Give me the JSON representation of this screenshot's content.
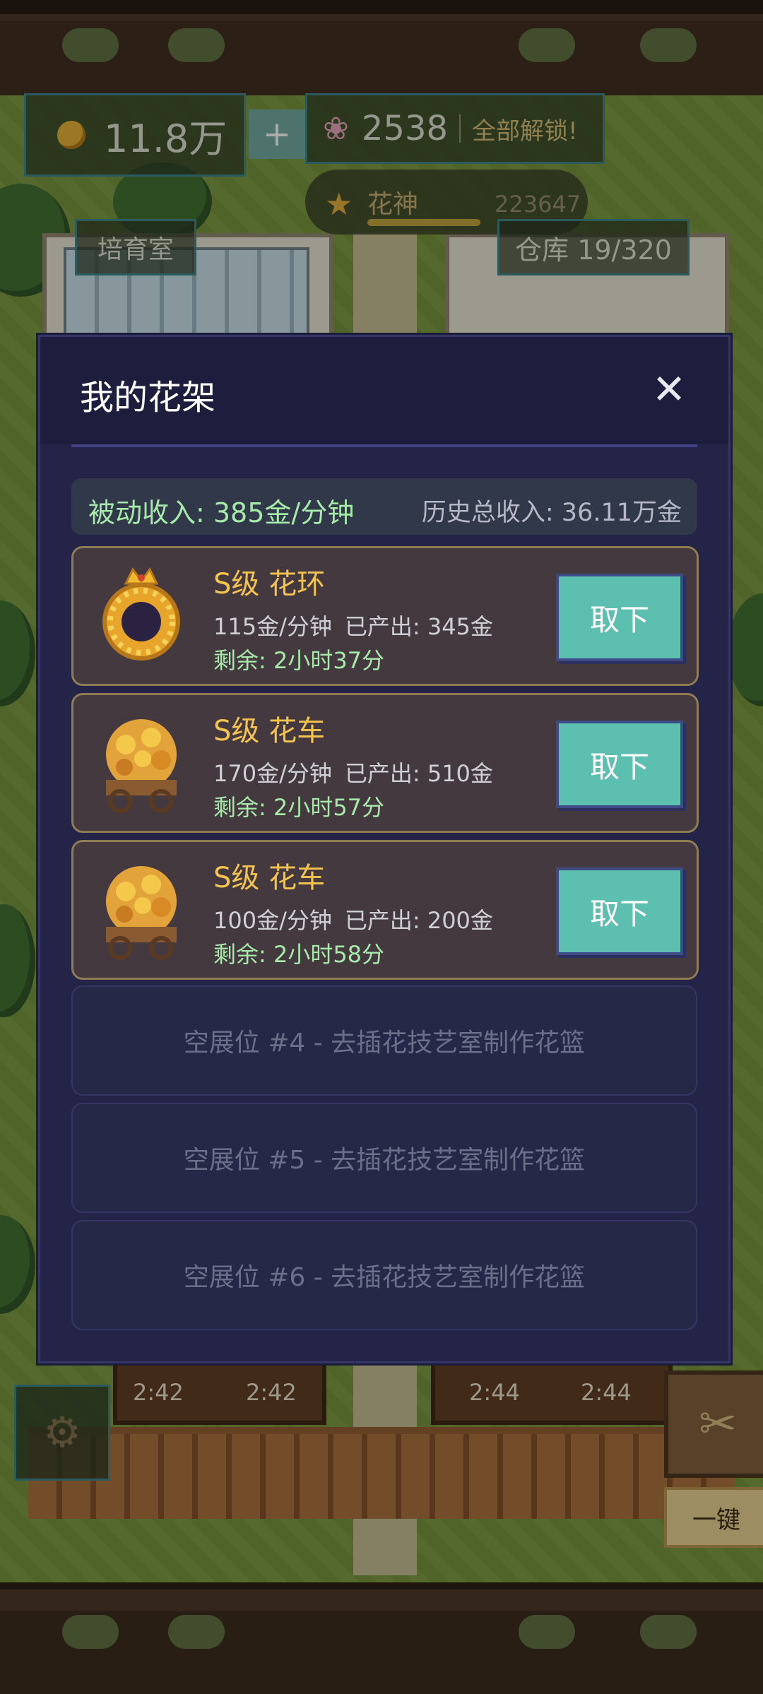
{
  "hud": {
    "coins": "11.8万",
    "add": "+",
    "flowers": "2538",
    "unlock_all": "全部解锁!",
    "rank_name": "花神",
    "rank_score": "223647",
    "nursery": "培育室",
    "warehouse": "仓库 19/320"
  },
  "timers": [
    "2:42",
    "2:42",
    "2:44",
    "2:44"
  ],
  "bottom": {
    "one_key": "一键"
  },
  "modal": {
    "title": "我的花架",
    "close": "✕",
    "passive_income": "被动收入: 385金/分钟",
    "total_income": "历史总收入: 36.11万金",
    "items": [
      {
        "name": "S级 花环",
        "rate": "115金/分钟",
        "produced": "已产出: 345金",
        "remaining": "剩余: 2小时37分",
        "button": "取下",
        "icon": "wreath-icon"
      },
      {
        "name": "S级 花车",
        "rate": "170金/分钟",
        "produced": "已产出: 510金",
        "remaining": "剩余: 2小时57分",
        "button": "取下",
        "icon": "flower-cart-icon"
      },
      {
        "name": "S级 花车",
        "rate": "100金/分钟",
        "produced": "已产出: 200金",
        "remaining": "剩余: 2小时58分",
        "button": "取下",
        "icon": "flower-cart-icon"
      }
    ],
    "empty_slots": [
      "空展位 #4 - 去插花技艺室制作花篮",
      "空展位 #5 - 去插花技艺室制作花篮",
      "空展位 #6 - 去插花技艺室制作花篮"
    ]
  },
  "colors": {
    "accent": "#5dbfb0",
    "gold": "#f2c34e",
    "income_green": "#a6e9a9",
    "modal_bg": "#232447"
  }
}
